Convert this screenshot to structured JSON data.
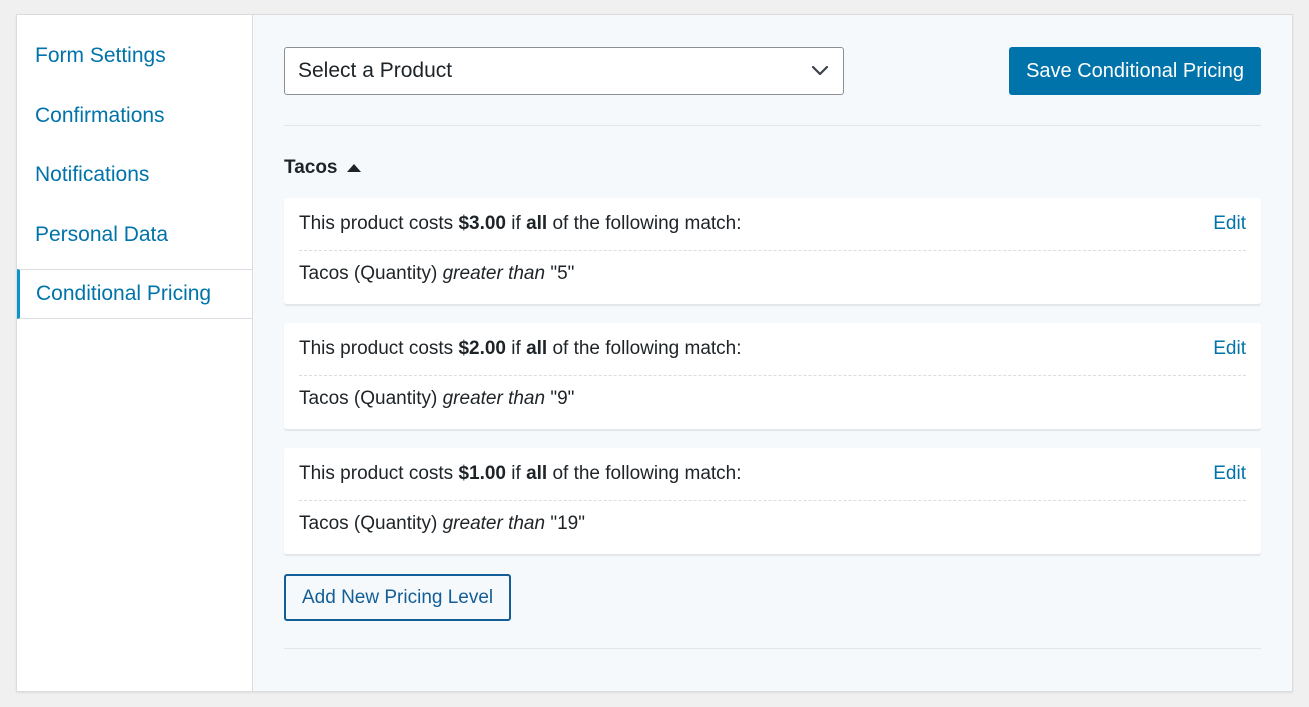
{
  "sidebar": {
    "items": [
      {
        "label": "Form Settings"
      },
      {
        "label": "Confirmations"
      },
      {
        "label": "Notifications"
      },
      {
        "label": "Personal Data"
      },
      {
        "label": "Conditional Pricing"
      }
    ],
    "active_index": 4
  },
  "toolbar": {
    "product_select_value": "Select a Product",
    "save_label": "Save Conditional Pricing"
  },
  "product": {
    "name": "Tacos"
  },
  "levels": [
    {
      "prefix": "This product costs ",
      "price": "$3.00",
      "mid": " if ",
      "match": "all",
      "suffix": " of the following match:",
      "edit_label": "Edit",
      "rule_field": "Tacos (Quantity) ",
      "rule_operator": "greater than",
      "rule_value": " \"5\""
    },
    {
      "prefix": "This product costs ",
      "price": "$2.00",
      "mid": " if ",
      "match": "all",
      "suffix": " of the following match:",
      "edit_label": "Edit",
      "rule_field": "Tacos (Quantity) ",
      "rule_operator": "greater than",
      "rule_value": " \"9\""
    },
    {
      "prefix": "This product costs ",
      "price": "$1.00",
      "mid": " if ",
      "match": "all",
      "suffix": " of the following match:",
      "edit_label": "Edit",
      "rule_field": "Tacos (Quantity) ",
      "rule_operator": "greater than",
      "rule_value": " \"19\""
    }
  ],
  "actions": {
    "add_label": "Add New Pricing Level"
  },
  "colors": {
    "link": "#0073aa",
    "button": "#0073aa",
    "active_border": "#0a95c9"
  },
  "icons": {
    "select": "chevron-down-icon",
    "collapse": "caret-up-icon"
  }
}
